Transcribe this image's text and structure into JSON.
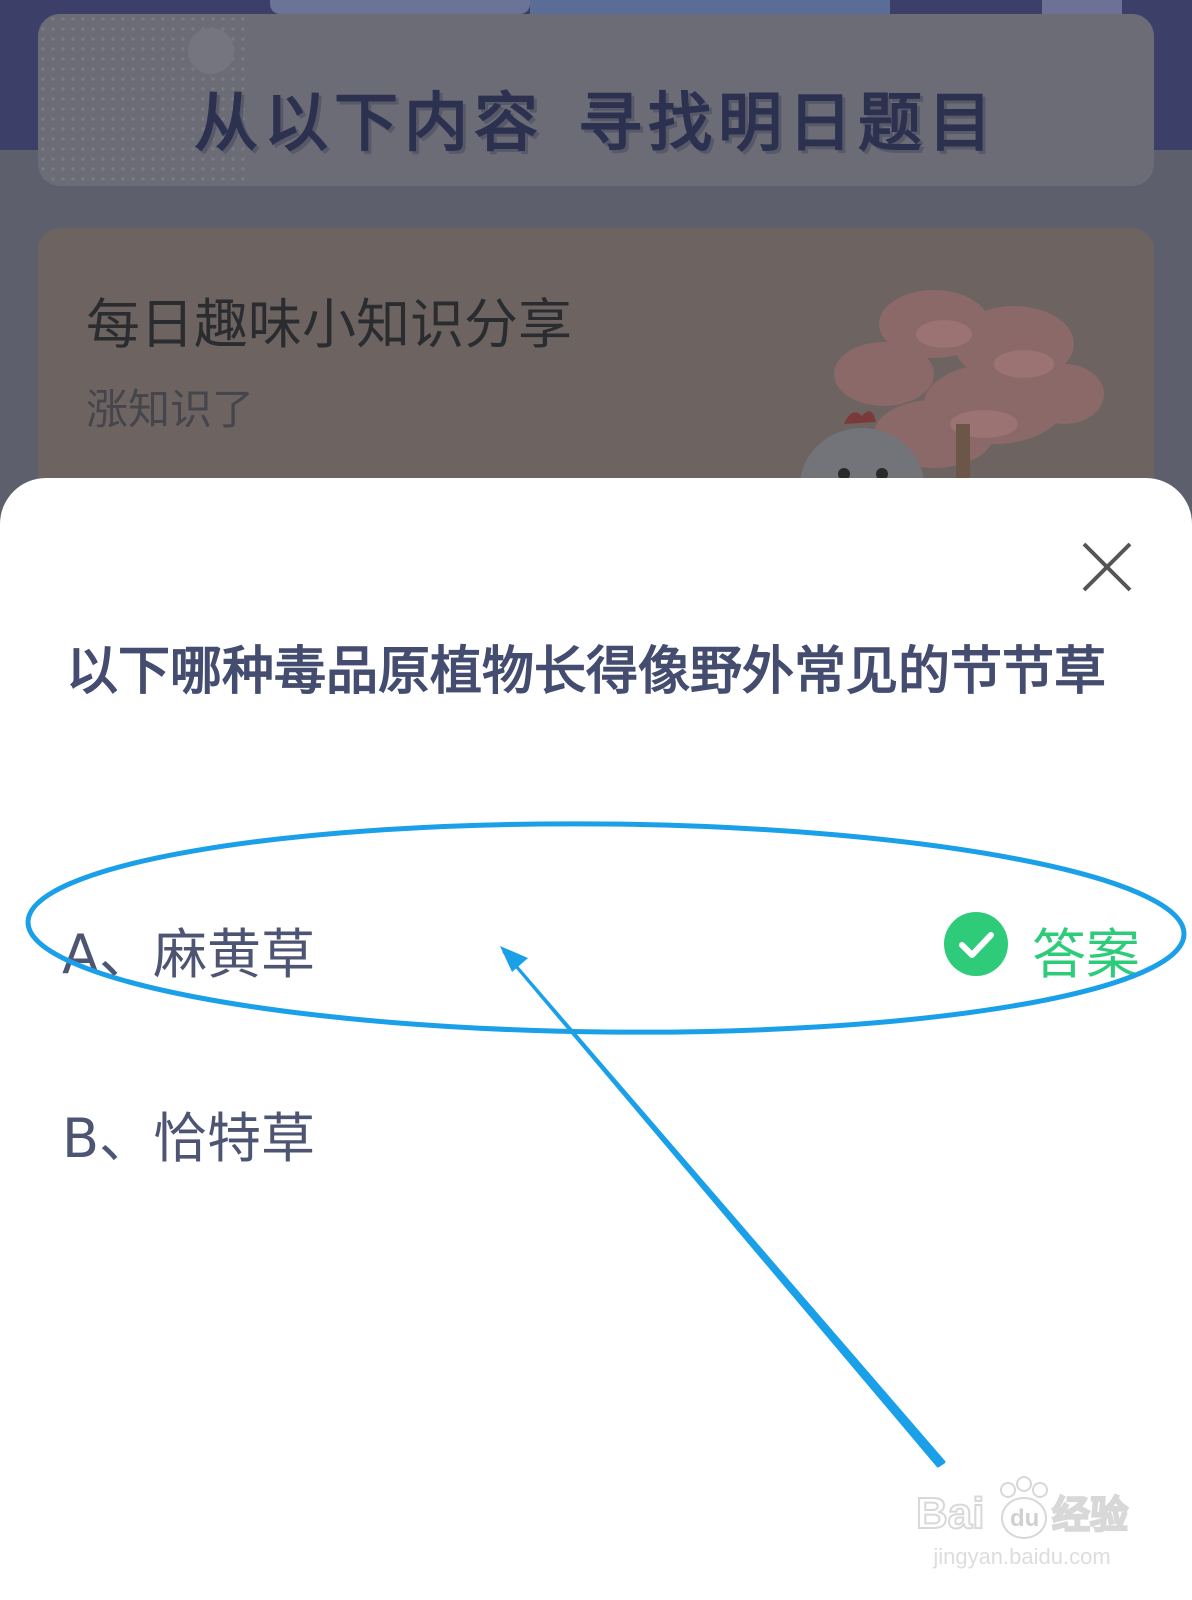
{
  "banner": {
    "title_left": "从以下内容",
    "title_right": "寻找明日题目"
  },
  "card": {
    "title": "每日趣味小知识分享",
    "subtitle": "涨知识了"
  },
  "quiz": {
    "question": "以下哪种毒品原植物长得像野外常见的节节草",
    "options": [
      {
        "label": "A、麻黄草",
        "is_answer": true
      },
      {
        "label": "B、恰特草",
        "is_answer": false
      }
    ],
    "answer_badge_label": "答案",
    "close_icon": "close-icon",
    "check_icon": "check-circle-icon"
  },
  "watermark": {
    "logo_text": "Baidu经验",
    "url": "jingyan.baidu.com"
  },
  "colors": {
    "question_text": "#444c70",
    "option_text": "#4d5573",
    "answer_green": "#2ecc7a",
    "annotation_blue": "#1aa0e8"
  }
}
